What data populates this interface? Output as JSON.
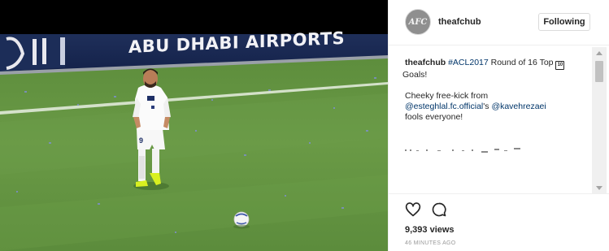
{
  "media": {
    "banner_text": "ABU DHABI AIRPORTS",
    "jersey_number": "9"
  },
  "post": {
    "avatar_text": "AFC",
    "username": "theafchub",
    "follow_label": "Following",
    "caption": {
      "author": "theafchub",
      "hashtag": "#ACL2017",
      "line1_text": " Round of 16 Top ",
      "keycap": "10",
      "line1_end": " Goals!",
      "line2": "Cheeky free-kick from",
      "mention1": "@esteghlal.fc.official",
      "line3_mid": "'s ",
      "mention2": "@kavehrezaei",
      "line4": "fools everyone!"
    },
    "views": "9,393 views",
    "timestamp": "46 MINUTES AGO"
  },
  "icons": {
    "like": "heart-icon",
    "comment": "comment-bubble-icon",
    "scroll_up": "arrow-up-icon",
    "scroll_down": "arrow-down-icon"
  },
  "colors": {
    "link": "#003569",
    "pitch": "#5f8f3e",
    "text": "#262626"
  }
}
